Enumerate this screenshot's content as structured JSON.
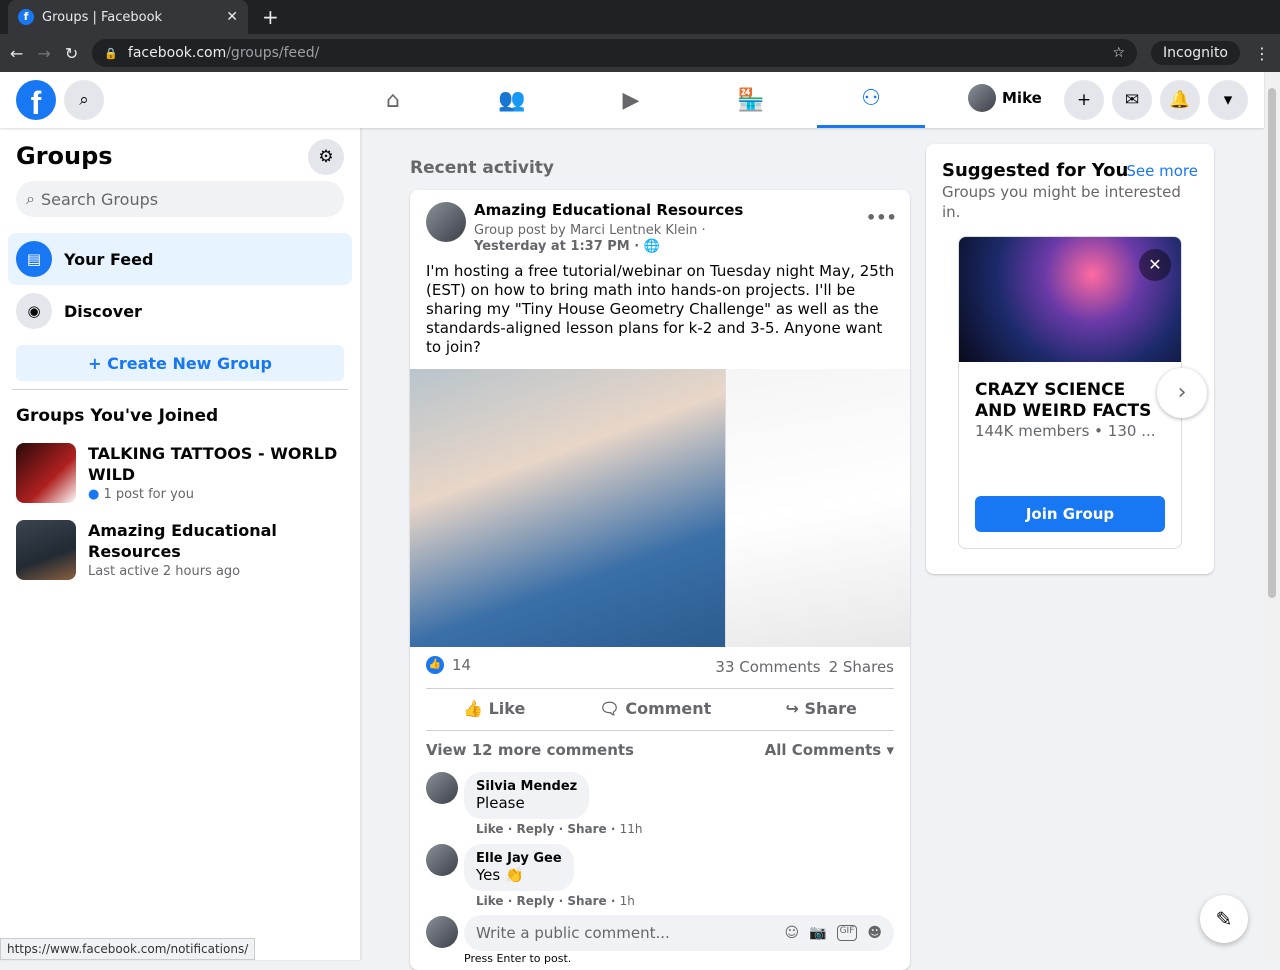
{
  "browser": {
    "tab_title": "Groups | Facebook",
    "url_host": "facebook.com",
    "url_path": "/groups/feed/",
    "profile": "Incognito",
    "status_url": "https://www.facebook.com/notifications/"
  },
  "header": {
    "user": "Mike"
  },
  "sidebar": {
    "title": "Groups",
    "search_placeholder": "Search Groups",
    "items": [
      {
        "label": "Your Feed"
      },
      {
        "label": "Discover"
      }
    ],
    "create_label": "+ Create New Group",
    "joined_title": "Groups You've Joined",
    "groups": [
      {
        "name": "TALKING TATTOOS - WORLD WILD",
        "meta": "1 post for you"
      },
      {
        "name": "Amazing Educational Resources",
        "meta": "Last active 2 hours ago"
      }
    ]
  },
  "main": {
    "section_title": "Recent activity",
    "post": {
      "group": "Amazing Educational Resources",
      "byline": "Group post by Marci Lentnek Klein ·",
      "time": "Yesterday at 1:37 PM ·",
      "text": "I'm hosting a free tutorial/webinar on Tuesday night May, 25th (EST) on how to bring math into hands-on projects. I'll be sharing my \"Tiny House Geometry Challenge\" as well as the standards-aligned lesson plans for k-2 and 3-5. Anyone want to join?",
      "likes": "14",
      "comments": "33 Comments",
      "shares": "2 Shares",
      "like_label": "Like",
      "comment_label": "Comment",
      "share_label": "Share",
      "view_more": "View 12 more comments",
      "all_comments": "All Comments",
      "comment_list": [
        {
          "author": "Silvia Mendez",
          "text": "Please",
          "like": "Like",
          "reply": "Reply",
          "share": "Share",
          "time": "11h"
        },
        {
          "author": "Elle Jay Gee",
          "text": "Yes 👏",
          "like": "Like",
          "reply": "Reply",
          "share": "Share",
          "time": "1h"
        }
      ],
      "comment_placeholder": "Write a public comment...",
      "hint": "Press Enter to post."
    }
  },
  "suggest": {
    "title": "Suggested for You",
    "see_more": "See more",
    "subtitle": "Groups you might be interested in.",
    "card_name": "CRAZY SCIENCE AND WEIRD FACTS",
    "card_meta": "144K members • 130 ...",
    "join": "Join Group"
  }
}
